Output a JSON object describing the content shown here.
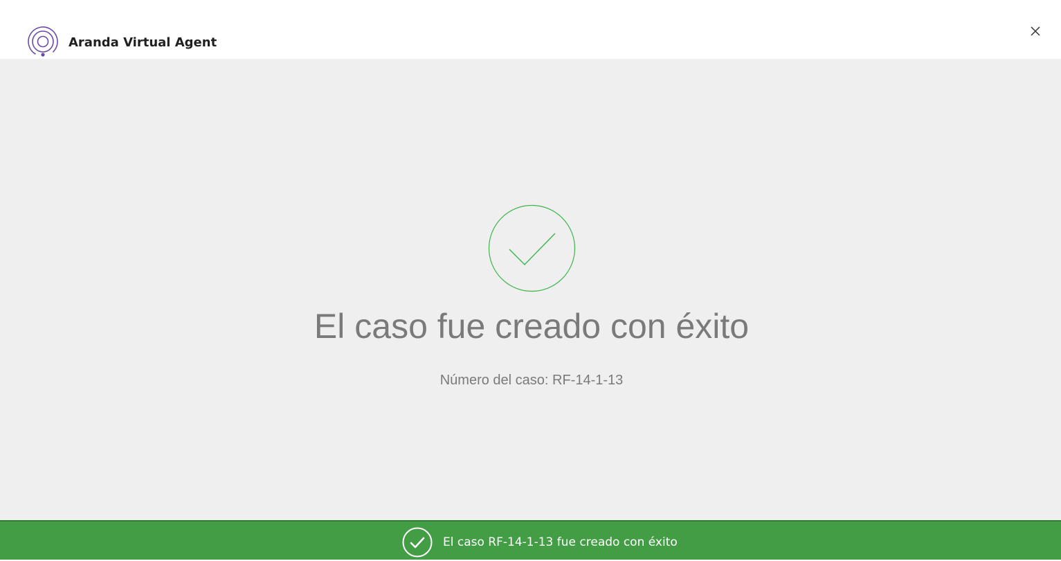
{
  "header": {
    "app_title": "Aranda Virtual Agent",
    "logo_icon": "aranda-spiral-logo-icon",
    "close_icon": "close-icon"
  },
  "main": {
    "success_icon": "checkmark-circle-icon",
    "title": "El caso fue creado con éxito",
    "case_number_line": "Número del caso: RF-14-1-13"
  },
  "toast": {
    "icon": "checkmark-circle-icon",
    "message": "El caso RF-14-1-13 fue creado con éxito"
  },
  "colors": {
    "brand_purple": "#6a4aa8",
    "success_green": "#439d45",
    "check_green": "#3cb54a",
    "text_gray": "#7a7a7a",
    "background_gray": "#efefef"
  }
}
